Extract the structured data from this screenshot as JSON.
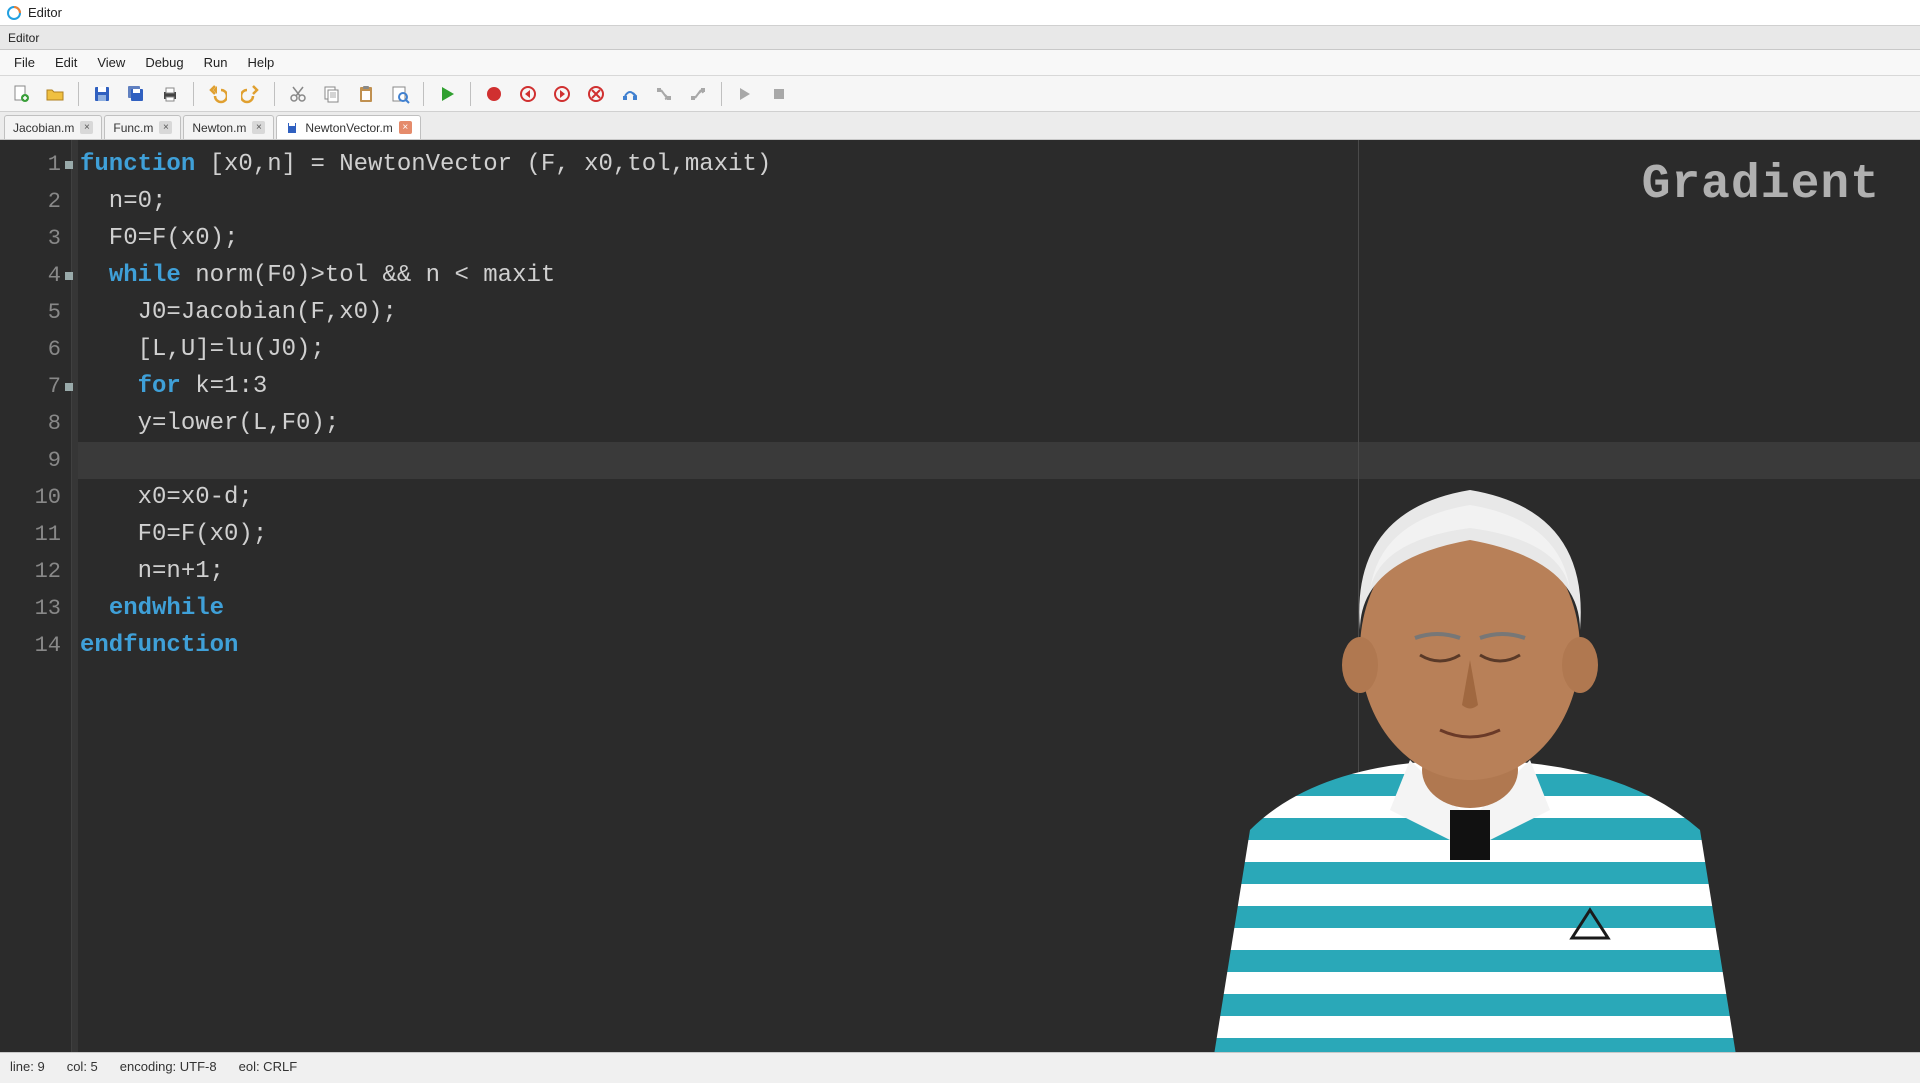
{
  "window": {
    "title": "Editor",
    "subtitle": "Editor"
  },
  "menu": {
    "file": "File",
    "edit": "Edit",
    "view": "View",
    "debug": "Debug",
    "run": "Run",
    "help": "Help"
  },
  "tabs": [
    {
      "label": "Jacobian.m",
      "modified": false,
      "active": false
    },
    {
      "label": "Func.m",
      "modified": false,
      "active": false
    },
    {
      "label": "Newton.m",
      "modified": false,
      "active": false
    },
    {
      "label": "NewtonVector.m",
      "modified": true,
      "active": true
    }
  ],
  "code": {
    "lines": [
      {
        "n": 1,
        "fold": true,
        "tokens": [
          {
            "t": "function",
            "c": "kw"
          },
          {
            "t": " [x0,n] = NewtonVector (F, x0,tol,maxit)",
            "c": "fn"
          }
        ]
      },
      {
        "n": 2,
        "fold": false,
        "tokens": [
          {
            "t": "  n=0;",
            "c": "fn"
          }
        ]
      },
      {
        "n": 3,
        "fold": false,
        "tokens": [
          {
            "t": "  F0=F(x0);",
            "c": "fn"
          }
        ]
      },
      {
        "n": 4,
        "fold": true,
        "tokens": [
          {
            "t": "  ",
            "c": "fn"
          },
          {
            "t": "while",
            "c": "kw"
          },
          {
            "t": " norm(F0)>tol && n < maxit",
            "c": "fn"
          }
        ]
      },
      {
        "n": 5,
        "fold": false,
        "tokens": [
          {
            "t": "    J0=Jacobian(F,x0);",
            "c": "fn"
          }
        ]
      },
      {
        "n": 6,
        "fold": false,
        "tokens": [
          {
            "t": "    [L,U]=lu(J0);",
            "c": "fn"
          }
        ]
      },
      {
        "n": 7,
        "fold": true,
        "tokens": [
          {
            "t": "    ",
            "c": "fn"
          },
          {
            "t": "for",
            "c": "kw"
          },
          {
            "t": " k=1:3",
            "c": "fn"
          }
        ]
      },
      {
        "n": 8,
        "fold": false,
        "tokens": [
          {
            "t": "    y=lower(L,F0);",
            "c": "fn"
          }
        ]
      },
      {
        "n": 9,
        "fold": false,
        "current": true,
        "tokens": [
          {
            "t": "    ",
            "c": "fn"
          }
        ]
      },
      {
        "n": 10,
        "fold": false,
        "tokens": [
          {
            "t": "    x0=x0-d;",
            "c": "fn"
          }
        ]
      },
      {
        "n": 11,
        "fold": false,
        "tokens": [
          {
            "t": "    F0=F(x0);",
            "c": "fn"
          }
        ]
      },
      {
        "n": 12,
        "fold": false,
        "tokens": [
          {
            "t": "    n=n+1;",
            "c": "fn"
          }
        ]
      },
      {
        "n": 13,
        "fold": false,
        "tokens": [
          {
            "t": "  ",
            "c": "fn"
          },
          {
            "t": "endwhile",
            "c": "kw"
          }
        ]
      },
      {
        "n": 14,
        "fold": false,
        "tokens": [
          {
            "t": "endfunction",
            "c": "kw"
          }
        ]
      }
    ]
  },
  "status": {
    "line": "line: 9",
    "col": "col: 5",
    "encoding": "encoding: UTF-8",
    "eol": "eol: CRLF"
  },
  "watermark": "Gradient",
  "icons": {
    "new": "new-file",
    "open": "open-folder",
    "save": "save",
    "saveall": "save-all",
    "print": "print",
    "undo": "undo",
    "redo": "redo",
    "cut": "cut",
    "copy": "copy",
    "paste": "paste",
    "find": "find-replace",
    "run": "run",
    "breakpoint": "toggle-breakpoint",
    "prevbp": "prev-breakpoint",
    "nextbp": "next-breakpoint",
    "clearbp": "clear-breakpoints",
    "stepover": "step-over",
    "stepin": "step-in",
    "stepout": "step-out",
    "continue": "continue",
    "stop": "stop"
  }
}
